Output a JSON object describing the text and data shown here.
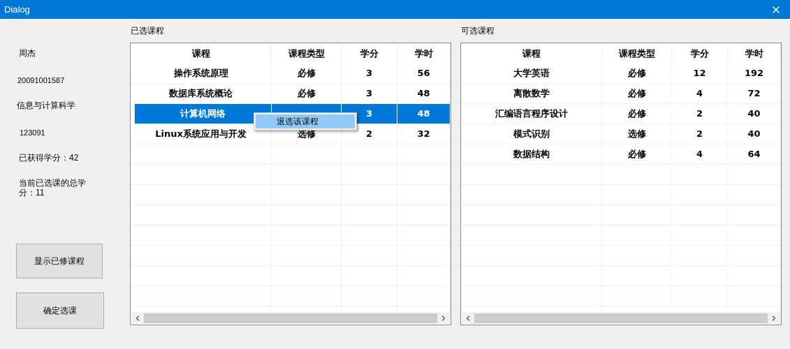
{
  "window": {
    "title": "Dialog"
  },
  "student": {
    "name": "周杰",
    "id": "20091001587",
    "major": "信息与计算科学",
    "class": "123091",
    "earned_credits": "已获得学分：42",
    "selected_credits": "当前已选课的总学分：11"
  },
  "buttons": [
    "显示已修课程",
    "确定选课"
  ],
  "selected_courses": {
    "title": "已选课程",
    "columns": [
      "课程",
      "课程类型",
      "学分",
      "学时"
    ],
    "rows": [
      {
        "cells": [
          "操作系统原理",
          "必修",
          "3",
          "56"
        ],
        "selected": false
      },
      {
        "cells": [
          "数据库系统概论",
          "必修",
          "3",
          "48"
        ],
        "selected": false
      },
      {
        "cells": [
          "计算机网络",
          null,
          "3",
          "48"
        ],
        "selected": true
      },
      {
        "cells": [
          "Linux系统应用与开发",
          "选修",
          "2",
          "32"
        ],
        "selected": false
      }
    ]
  },
  "context_menu": {
    "items": [
      {
        "label": "退选该课程",
        "selected": true
      }
    ]
  },
  "available_courses": {
    "title": "可选课程",
    "columns": [
      "课程",
      "课程类型",
      "学分",
      "学时"
    ],
    "rows": [
      {
        "cells": [
          "大学英语",
          "必修",
          "12",
          "192"
        ],
        "selected": false
      },
      {
        "cells": [
          "离散数学",
          "必修",
          "4",
          "72"
        ],
        "selected": false
      },
      {
        "cells": [
          "汇编语言程序设计",
          "必修",
          "2",
          "40"
        ],
        "selected": false
      },
      {
        "cells": [
          "模式识别",
          "选修",
          "2",
          "40"
        ],
        "selected": false
      },
      {
        "cells": [
          "数据结构",
          "必修",
          "4",
          "64"
        ],
        "selected": false
      }
    ]
  }
}
